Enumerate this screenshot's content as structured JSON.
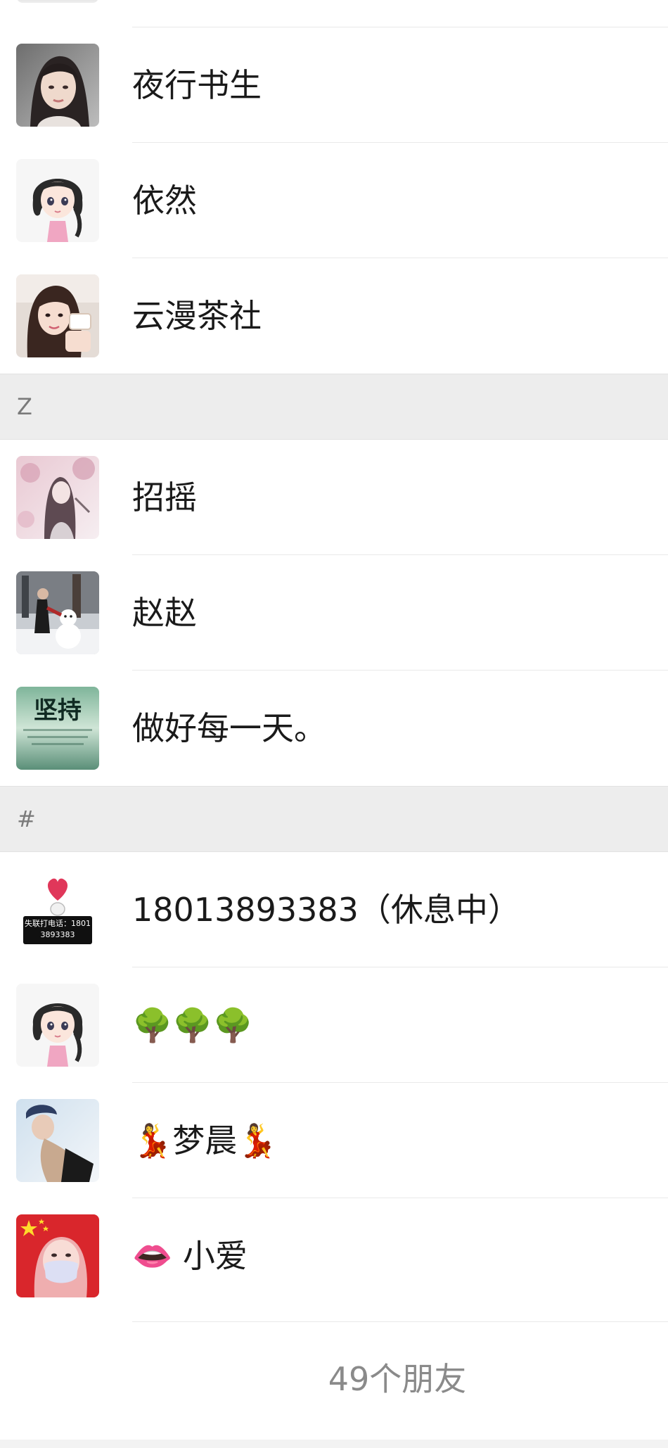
{
  "contacts": [
    {
      "name": "夜行书生",
      "avatar": "avatar-woman-dark-hair"
    },
    {
      "name": "依然",
      "avatar": "avatar-cartoon-girl-pink-dress"
    },
    {
      "name": "云漫茶社",
      "avatar": "avatar-woman-holding-cup"
    }
  ],
  "section_z": {
    "letter": "Z",
    "contacts": [
      {
        "name": "招摇",
        "avatar": "avatar-pink-blossom-woman"
      },
      {
        "name": "赵赵",
        "avatar": "avatar-snowman-photo"
      },
      {
        "name": "做好每一天。",
        "avatar": "avatar-jianchi-text-image",
        "avatar_text": "坚持"
      }
    ]
  },
  "section_hash": {
    "letter": "#",
    "contacts": [
      {
        "name": "18013893383（休息中）",
        "avatar": "avatar-heart-sign",
        "avatar_text": "失联打电话：18013893383"
      },
      {
        "name": "🌳🌳🌳",
        "avatar": "avatar-cartoon-girl-pink-dress"
      },
      {
        "name": "💃梦晨💃",
        "avatar": "avatar-woman-cap-photo"
      },
      {
        "name": "👄 小爱",
        "avatar": "avatar-flag-mask-woman"
      }
    ]
  },
  "footer": {
    "friend_count": "49个朋友"
  },
  "colors": {
    "section_bg": "#ededed",
    "divider": "#e9e9e9",
    "name_text": "#1a1a1a",
    "count_text": "#8a8a8a"
  }
}
